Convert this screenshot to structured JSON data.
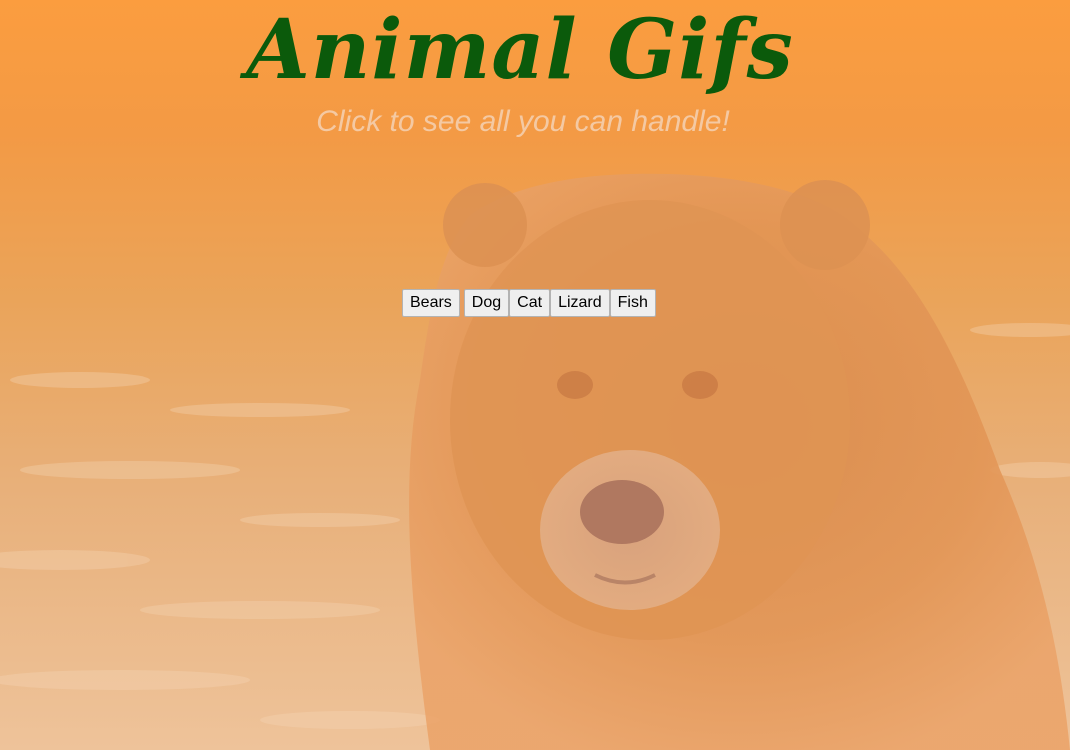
{
  "header": {
    "title": "Animal Gifs",
    "subtitle": "Click to see all you can handle!"
  },
  "buttons": [
    {
      "label": "Bears"
    },
    {
      "label": "Dog"
    },
    {
      "label": "Cat"
    },
    {
      "label": "Lizard"
    },
    {
      "label": "Fish"
    }
  ],
  "colors": {
    "title": "#0b5a0b",
    "subtitle": "#f4c9a3",
    "background_tint": "#fb9d3f"
  }
}
